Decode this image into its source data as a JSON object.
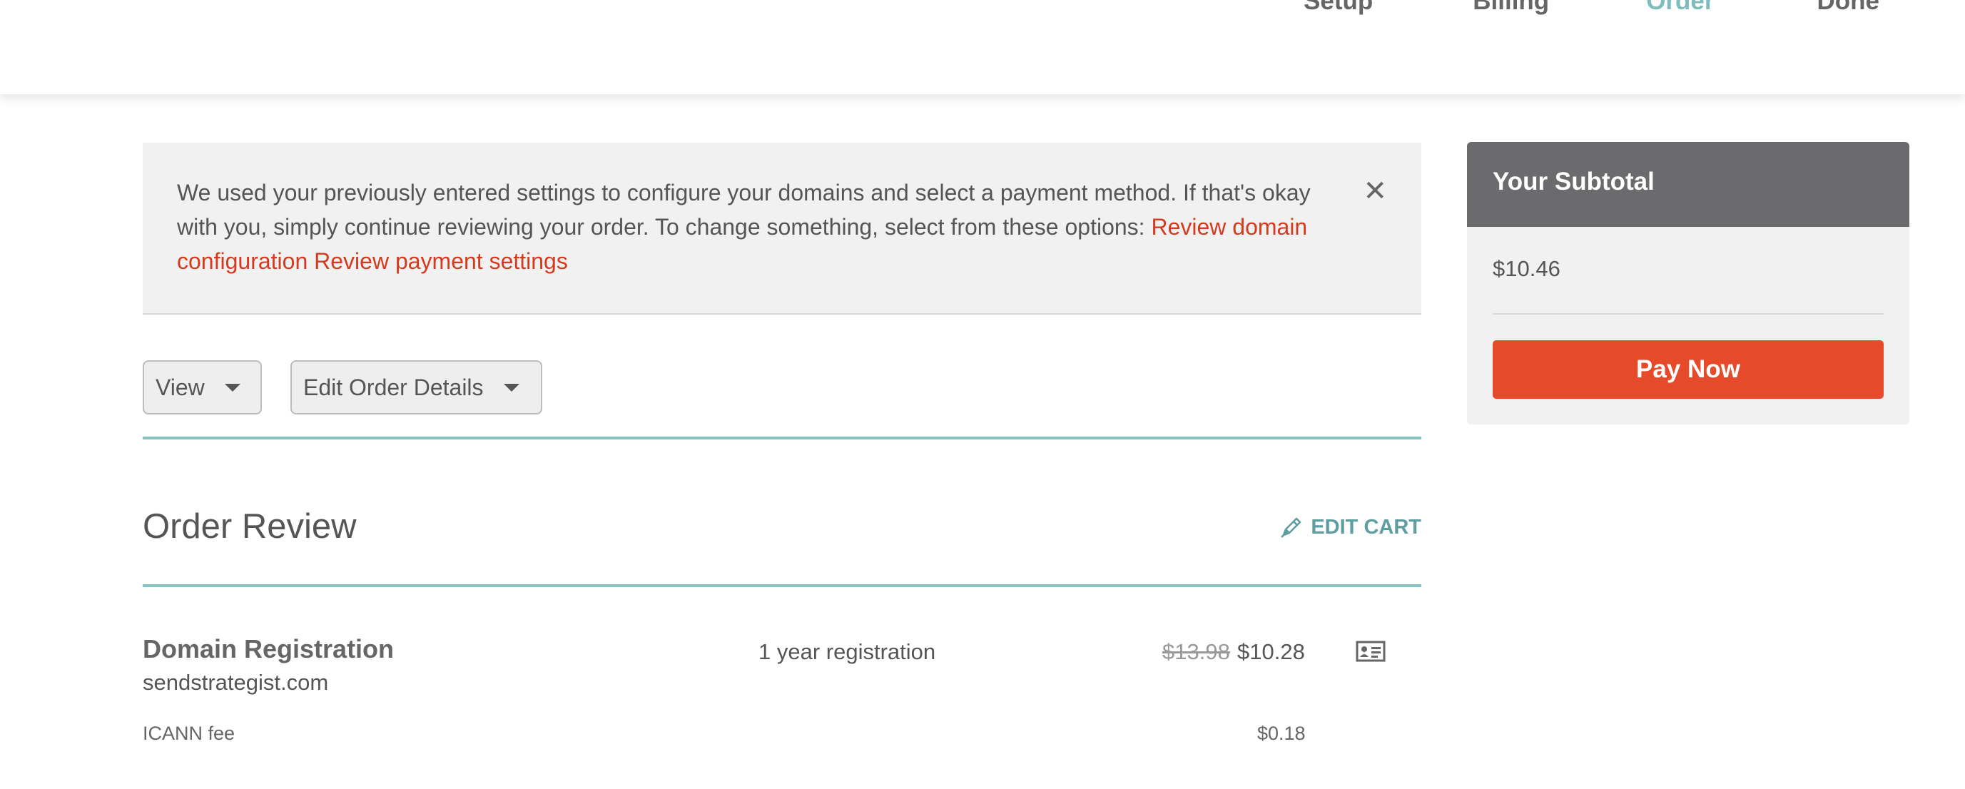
{
  "steps": {
    "setup": "Setup",
    "billing": "Billing",
    "order": "Order",
    "done": "Done",
    "active_color": "#7fbcbc"
  },
  "notice": {
    "text": "We used your previously entered settings to configure your domains and select a payment method. If that's okay with you, simply continue reviewing your order. To change something, select from these options: ",
    "link_domain": "Review domain configuration",
    "link_payment": "Review payment settings",
    "close_icon": "close-icon",
    "close_glyph": "✕"
  },
  "toolbar": {
    "view_label": "View",
    "edit_label": "Edit Order Details"
  },
  "order_review": {
    "title": "Order Review",
    "edit_cart_label": "EDIT CART",
    "edit_cart_icon": "pencil-icon"
  },
  "items": [
    {
      "title": "Domain Registration",
      "domain": "sendstrategist.com",
      "term": "1 year registration",
      "old_price": "$13.98",
      "price": "$10.28",
      "icon": "contact-card-icon"
    }
  ],
  "fees": {
    "icann_label": "ICANN fee",
    "icann_amount": "$0.18"
  },
  "sidebar": {
    "title": "Your Subtotal",
    "amount": "$10.46",
    "pay_label": "Pay Now",
    "accent": "#e54a2b"
  }
}
